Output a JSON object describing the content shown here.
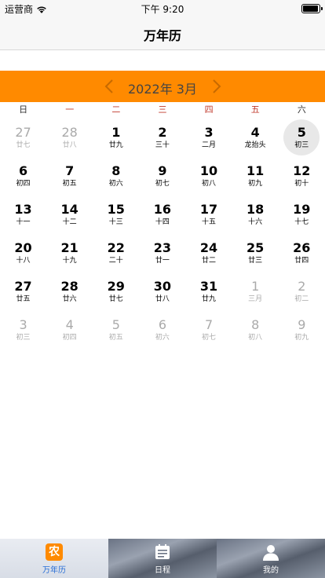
{
  "status_bar": {
    "carrier": "运营商",
    "time": "下午 9:20",
    "battery_level": 1.0
  },
  "nav": {
    "title": "万年历"
  },
  "calendar": {
    "month_label": "2022年 3月",
    "weekdays": [
      "日",
      "一",
      "二",
      "三",
      "四",
      "五",
      "六"
    ],
    "weekday_red": [
      false,
      true,
      true,
      true,
      true,
      true,
      false
    ],
    "days": [
      {
        "n": "27",
        "l": "廿七",
        "m": true
      },
      {
        "n": "28",
        "l": "廿八",
        "m": true
      },
      {
        "n": "1",
        "l": "廿九"
      },
      {
        "n": "2",
        "l": "三十"
      },
      {
        "n": "3",
        "l": "二月"
      },
      {
        "n": "4",
        "l": "龙抬头"
      },
      {
        "n": "5",
        "l": "初三",
        "today": true
      },
      {
        "n": "6",
        "l": "初四"
      },
      {
        "n": "7",
        "l": "初五"
      },
      {
        "n": "8",
        "l": "初六"
      },
      {
        "n": "9",
        "l": "初七"
      },
      {
        "n": "10",
        "l": "初八"
      },
      {
        "n": "11",
        "l": "初九"
      },
      {
        "n": "12",
        "l": "初十"
      },
      {
        "n": "13",
        "l": "十一"
      },
      {
        "n": "14",
        "l": "十二"
      },
      {
        "n": "15",
        "l": "十三"
      },
      {
        "n": "16",
        "l": "十四"
      },
      {
        "n": "17",
        "l": "十五"
      },
      {
        "n": "18",
        "l": "十六"
      },
      {
        "n": "19",
        "l": "十七"
      },
      {
        "n": "20",
        "l": "十八"
      },
      {
        "n": "21",
        "l": "十九"
      },
      {
        "n": "22",
        "l": "二十"
      },
      {
        "n": "23",
        "l": "廿一"
      },
      {
        "n": "24",
        "l": "廿二"
      },
      {
        "n": "25",
        "l": "廿三"
      },
      {
        "n": "26",
        "l": "廿四"
      },
      {
        "n": "27",
        "l": "廿五"
      },
      {
        "n": "28",
        "l": "廿六"
      },
      {
        "n": "29",
        "l": "廿七"
      },
      {
        "n": "30",
        "l": "廿八"
      },
      {
        "n": "31",
        "l": "廿九"
      },
      {
        "n": "1",
        "l": "三月",
        "m": true
      },
      {
        "n": "2",
        "l": "初二",
        "m": true
      },
      {
        "n": "3",
        "l": "初三",
        "m": true
      },
      {
        "n": "4",
        "l": "初四",
        "m": true
      },
      {
        "n": "5",
        "l": "初五",
        "m": true
      },
      {
        "n": "6",
        "l": "初六",
        "m": true
      },
      {
        "n": "7",
        "l": "初七",
        "m": true
      },
      {
        "n": "8",
        "l": "初八",
        "m": true
      },
      {
        "n": "9",
        "l": "初九",
        "m": true
      }
    ]
  },
  "tabs": [
    {
      "label": "万年历",
      "icon": "nong-calendar-icon",
      "icon_text": "农",
      "active": true
    },
    {
      "label": "日程",
      "icon": "schedule-icon",
      "active": false
    },
    {
      "label": "我的",
      "icon": "profile-icon",
      "active": false
    }
  ],
  "colors": {
    "accent": "#ff8a00",
    "active_tab": "#2a6fd6",
    "weekday_red": "#c0392b",
    "muted": "#aaaaaa"
  }
}
